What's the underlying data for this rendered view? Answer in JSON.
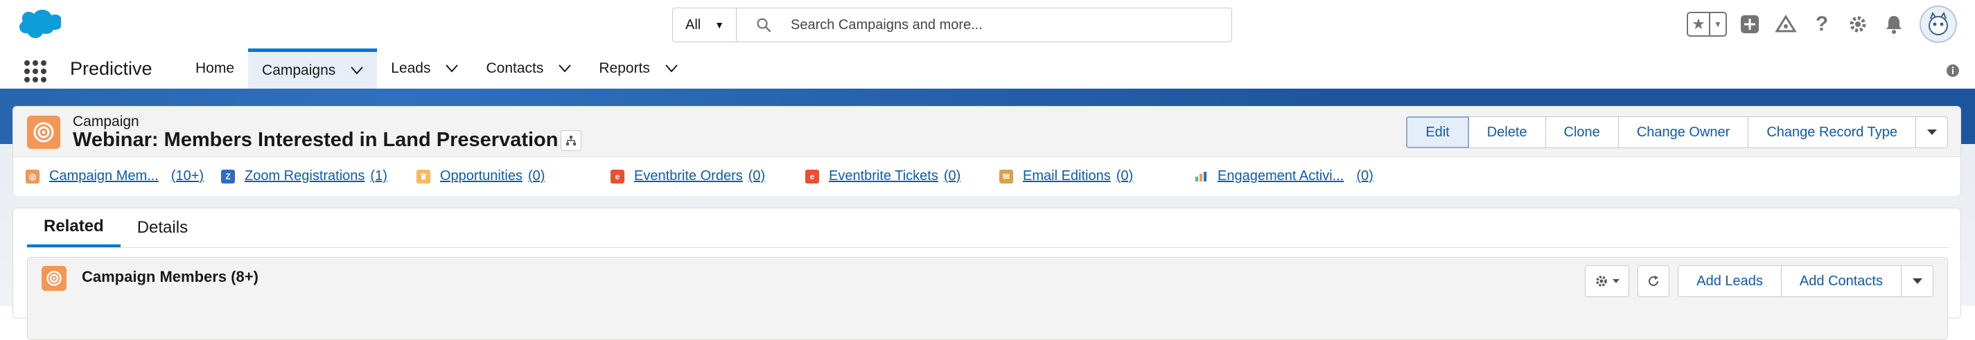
{
  "global_header": {
    "search_scope": "All",
    "search_placeholder": "Search Campaigns and more...",
    "icons": [
      "favorites-star-icon",
      "add-icon",
      "trailhead-icon",
      "help-icon",
      "settings-gear-icon",
      "notifications-bell-icon",
      "avatar"
    ]
  },
  "nav": {
    "app_name": "Predictive",
    "items": [
      {
        "label": "Home",
        "has_menu": false,
        "active": false
      },
      {
        "label": "Campaigns",
        "has_menu": true,
        "active": true
      },
      {
        "label": "Leads",
        "has_menu": true,
        "active": false
      },
      {
        "label": "Contacts",
        "has_menu": true,
        "active": false
      },
      {
        "label": "Reports",
        "has_menu": true,
        "active": false
      }
    ]
  },
  "record": {
    "object_type": "Campaign",
    "title": "Webinar: Members Interested in Land Preservation",
    "actions": [
      "Edit",
      "Delete",
      "Clone",
      "Change Owner",
      "Change Record Type"
    ]
  },
  "related_links": [
    {
      "label": "Campaign Mem...",
      "count": "(10+)",
      "icon": "campaign-members-icon",
      "color": "#f49756"
    },
    {
      "label": "Zoom Registrations",
      "count": "(1)",
      "icon": "zoom-icon",
      "color": "#2d6cc0"
    },
    {
      "label": "Opportunities",
      "count": "(0)",
      "icon": "opportunity-icon",
      "color": "#fcb95b"
    },
    {
      "label": "Eventbrite Orders",
      "count": "(0)",
      "icon": "eventbrite-icon",
      "color": "#ea4f2f"
    },
    {
      "label": "Eventbrite Tickets",
      "count": "(0)",
      "icon": "eventbrite-icon",
      "color": "#ea4f2f"
    },
    {
      "label": "Email Editions",
      "count": "(0)",
      "icon": "email-icon",
      "color": "#d8a14a"
    },
    {
      "label": "Engagement Activi...",
      "count": "(0)",
      "icon": "engagement-chart-icon",
      "color": "#4bc076"
    }
  ],
  "tabs": [
    {
      "label": "Related",
      "active": true
    },
    {
      "label": "Details",
      "active": false
    }
  ],
  "campaign_members_card": {
    "title": "Campaign Members (8+)",
    "buttons": [
      "Add Leads",
      "Add Contacts"
    ]
  },
  "colors": {
    "brand_blue": "#0176d3",
    "link_blue": "#0b5cab",
    "campaign_orange": "#f49756",
    "header_band": "#1d569c"
  }
}
